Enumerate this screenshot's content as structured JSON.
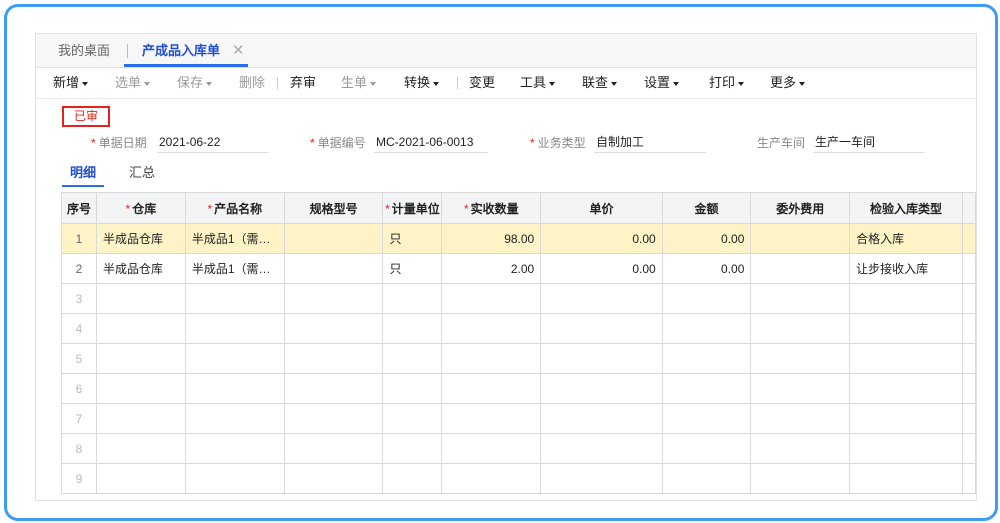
{
  "tabs": {
    "home": "我的桌面",
    "active": "产成品入库单",
    "close_glyph": "✕"
  },
  "toolbar": {
    "items": [
      {
        "label": "新增",
        "dropdown": true,
        "enabled": true
      },
      {
        "label": "选单",
        "dropdown": true,
        "enabled": false
      },
      {
        "label": "保存",
        "dropdown": true,
        "enabled": false
      },
      {
        "label": "删除",
        "dropdown": false,
        "enabled": false
      },
      {
        "label": "弃审",
        "dropdown": false,
        "enabled": true
      },
      {
        "label": "生单",
        "dropdown": true,
        "enabled": false
      },
      {
        "label": "转换",
        "dropdown": true,
        "enabled": true
      },
      {
        "label": "变更",
        "dropdown": false,
        "enabled": true
      },
      {
        "label": "工具",
        "dropdown": true,
        "enabled": true
      },
      {
        "label": "联查",
        "dropdown": true,
        "enabled": true
      },
      {
        "label": "设置",
        "dropdown": true,
        "enabled": true
      },
      {
        "label": "打印",
        "dropdown": true,
        "enabled": true
      },
      {
        "label": "更多",
        "dropdown": true,
        "enabled": true
      }
    ]
  },
  "status_badge": "已审",
  "header": {
    "doc_date": {
      "label": "单据日期",
      "value": "2021-06-22",
      "required": true
    },
    "doc_no": {
      "label": "单据编号",
      "value": "MC-2021-06-0013",
      "required": true
    },
    "biz_type": {
      "label": "业务类型",
      "value": "自制加工",
      "required": true
    },
    "workshop": {
      "label": "生产车间",
      "value": "生产一车间",
      "required": false
    }
  },
  "subtabs": {
    "detail": "明细",
    "summary": "汇总"
  },
  "table": {
    "columns": [
      {
        "label": "序号",
        "required": false
      },
      {
        "label": "仓库",
        "required": true
      },
      {
        "label": "产品名称",
        "required": true
      },
      {
        "label": "规格型号",
        "required": false
      },
      {
        "label": "计量单位",
        "required": true
      },
      {
        "label": "实收数量",
        "required": true
      },
      {
        "label": "单价",
        "required": false
      },
      {
        "label": "金额",
        "required": false
      },
      {
        "label": "委外费用",
        "required": false
      },
      {
        "label": "检验入库类型",
        "required": false
      }
    ],
    "rows": [
      {
        "idx": "1",
        "warehouse": "半成品仓库",
        "product": "半成品1（需…",
        "spec": "",
        "unit": "只",
        "qty": "98.00",
        "price": "0.00",
        "amount": "0.00",
        "outsource": "",
        "inspect": "合格入库"
      },
      {
        "idx": "2",
        "warehouse": "半成品仓库",
        "product": "半成品1（需…",
        "spec": "",
        "unit": "只",
        "qty": "2.00",
        "price": "0.00",
        "amount": "0.00",
        "outsource": "",
        "inspect": "让步接收入库"
      }
    ],
    "empty_rows": [
      "3",
      "4",
      "5",
      "6",
      "7",
      "8",
      "9"
    ]
  }
}
